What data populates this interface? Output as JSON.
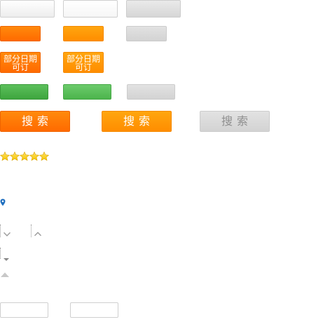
{
  "two_line_buttons": {
    "orange_dark": {
      "line1": "部分日期",
      "line2": "可订"
    },
    "orange_light": {
      "line1": "部分日期",
      "line2": "可订"
    }
  },
  "search_buttons": {
    "orange_dark_label": "搜索",
    "orange_light_label": "搜索",
    "disabled_label": "搜索"
  },
  "rating": {
    "value": 5,
    "max": 5
  },
  "colors": {
    "orange_dark": "#ff6a00",
    "orange_light": "#ff9600",
    "green": "#4cb44c",
    "disabled_gray": "#d6d6d6",
    "star_yellow": "#f5c400",
    "map_pin_blue": "#1f6fbf",
    "chevron_gray": "#9a9a9a"
  },
  "icons": {
    "rating_star": "star-icon",
    "location": "map-pin-icon",
    "sort_down": "chevron-down-icon",
    "sort_up": "chevron-up-icon",
    "dropdown_caret": "caret-down-icon",
    "collapse_caret": "caret-up-icon"
  },
  "inputs": {
    "field_1": {
      "value": "",
      "placeholder": ""
    },
    "field_2": {
      "value": "",
      "placeholder": ""
    }
  }
}
